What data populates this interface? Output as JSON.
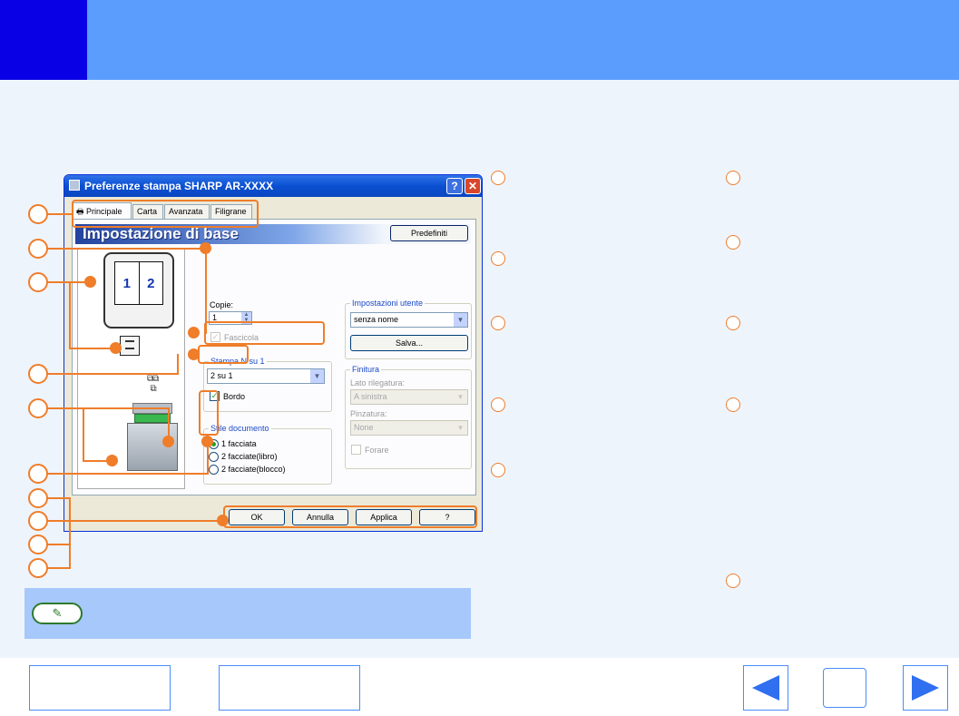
{
  "dialog": {
    "title": "Preferenze stampa SHARP AR-XXXX",
    "help_label": "?",
    "close_label": "✕",
    "tabs": [
      "Principale",
      "Carta",
      "Avanzata",
      "Filigrane"
    ],
    "banner_title": "Impostazione di base",
    "defaults_label": "Predefiniti",
    "preview": {
      "page_numbers": [
        "1",
        "2"
      ]
    },
    "copies": {
      "label": "Copie:",
      "value": "1"
    },
    "collate": {
      "label": "Fascicola",
      "checked": true,
      "disabled": true
    },
    "n_up": {
      "group_label": "Stampa N su 1",
      "value": "2 su 1"
    },
    "border": {
      "label": "Bordo",
      "checked": true
    },
    "document_style": {
      "group_label": "Stile documento",
      "options": [
        "1 facciata",
        "2 facciate(libro)",
        "2 facciate(blocco)"
      ],
      "selected": 0
    },
    "user_settings": {
      "group_label": "Impostazioni utente",
      "value": "senza nome",
      "save_label": "Salva..."
    },
    "finishing": {
      "group_label": "Finitura",
      "binding_label": "Lato rilegatura:",
      "binding_value": "A sinistra",
      "staple_label": "Pinzatura:",
      "staple_value": "None",
      "punch_label": "Forare"
    },
    "buttons": {
      "ok": "OK",
      "cancel": "Annulla",
      "apply": "Applica",
      "help": "?"
    }
  },
  "note": {
    "icon": "pencil-note-icon",
    "glyph": "✎"
  },
  "colors": {
    "header": "#5b9dfd",
    "header_block": "#0a00e6",
    "accent": "#ef7d2a",
    "content_bg": "#eef4fc",
    "note_bg": "#a6c8fa"
  },
  "icons": [
    "printer-icon",
    "pencil-note-icon",
    "arrow-left-icon",
    "arrow-right-icon"
  ]
}
